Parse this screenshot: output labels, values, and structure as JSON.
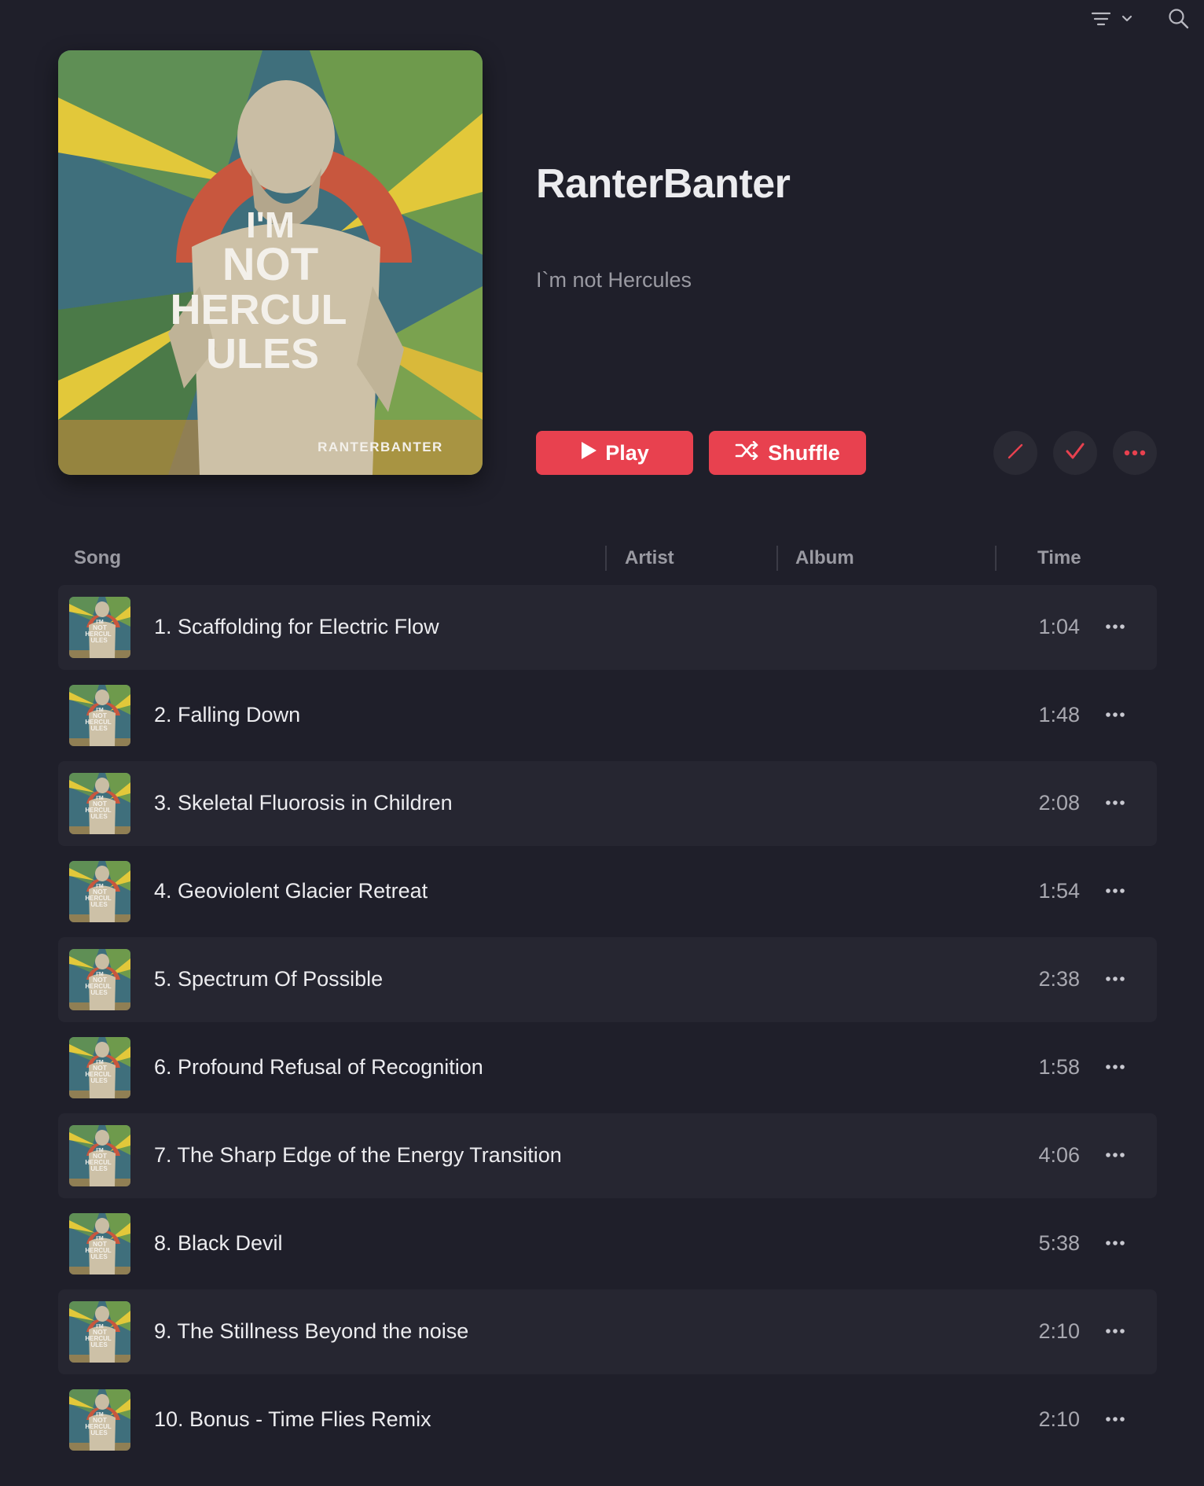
{
  "toolbar": {
    "sort_icon": "list-sort-icon",
    "search_icon": "search-icon"
  },
  "album": {
    "title": "RanterBanter",
    "subtitle": "I`m not Hercules",
    "cover_text": [
      "I'M",
      "NOT",
      "HERCUL",
      "ULES"
    ],
    "cover_brand": "RANTERBANTER"
  },
  "actions": {
    "play_label": "Play",
    "shuffle_label": "Shuffle",
    "edit_icon": "pencil-icon",
    "done_icon": "checkmark-icon",
    "more_icon": "more-icon"
  },
  "columns": {
    "song": "Song",
    "artist": "Artist",
    "album": "Album",
    "time": "Time"
  },
  "tracks": [
    {
      "title": "1. Scaffolding for Electric Flow",
      "time": "1:04"
    },
    {
      "title": "2. Falling Down",
      "time": "1:48"
    },
    {
      "title": "3. Skeletal Fluorosis in Children",
      "time": "2:08"
    },
    {
      "title": "4. Geoviolent Glacier Retreat",
      "time": "1:54"
    },
    {
      "title": "5. Spectrum Of Possible",
      "time": "2:38"
    },
    {
      "title": "6. Profound Refusal of Recognition",
      "time": "1:58"
    },
    {
      "title": "7. The Sharp Edge of the Energy Transition",
      "time": "4:06"
    },
    {
      "title": "8. Black Devil",
      "time": "5:38"
    },
    {
      "title": "9. The Stillness Beyond the noise",
      "time": "2:10"
    },
    {
      "title": "10. Bonus - Time Flies Remix",
      "time": "2:10"
    }
  ],
  "colors": {
    "background": "#1f1f2a",
    "accent": "#e8414f",
    "row_alt": "#262631"
  }
}
